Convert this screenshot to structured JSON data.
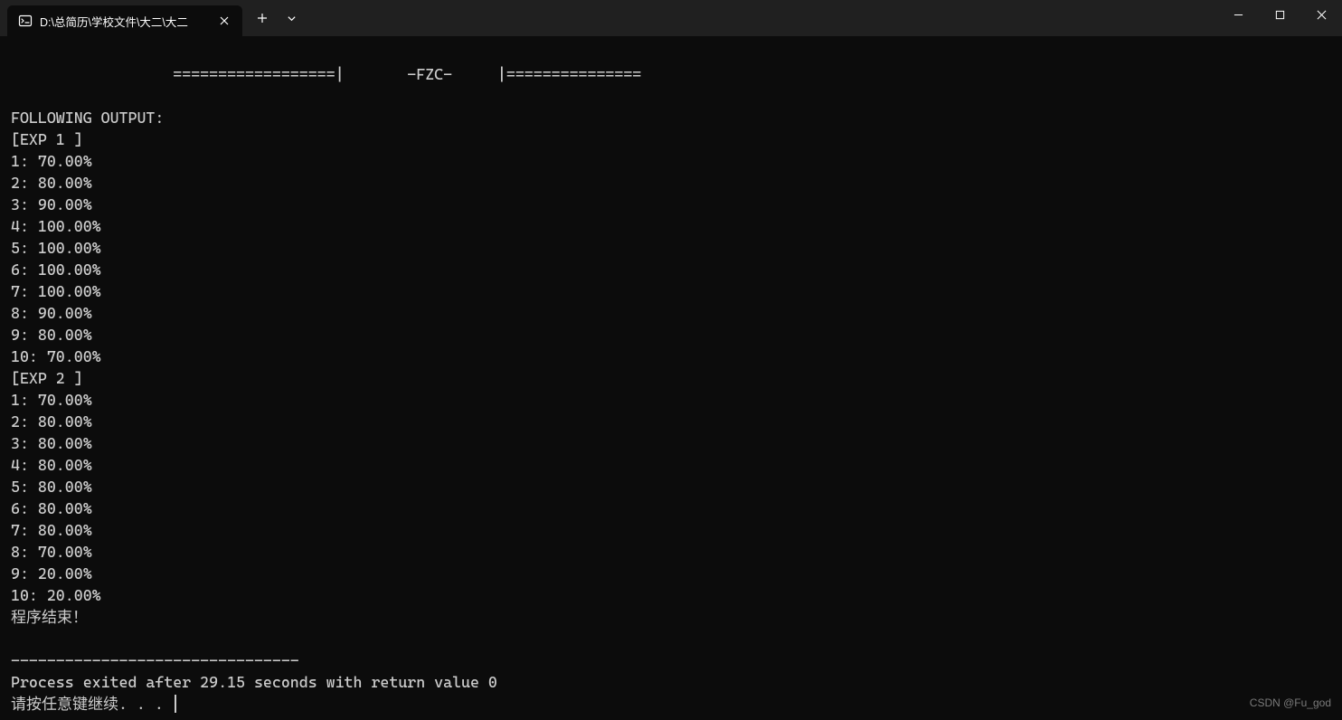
{
  "titlebar": {
    "tab_title": "D:\\总简历\\学校文件\\大二\\大二",
    "new_tab_icon": "＋",
    "dropdown_icon": "⌄"
  },
  "window_controls": {
    "minimize": "—",
    "maximize": "▢",
    "close": "✕"
  },
  "terminal": {
    "banner": "                  ==================|       -FZC-     |===============",
    "following_output": "FOLLOWING OUTPUT:",
    "exp1_header": "[EXP 1 ]",
    "exp1_lines": [
      "1: 70.00%",
      "2: 80.00%",
      "3: 90.00%",
      "4: 100.00%",
      "5: 100.00%",
      "6: 100.00%",
      "7: 100.00%",
      "8: 90.00%",
      "9: 80.00%",
      "10: 70.00%"
    ],
    "exp2_header": "[EXP 2 ]",
    "exp2_lines": [
      "1: 70.00%",
      "2: 80.00%",
      "3: 80.00%",
      "4: 80.00%",
      "5: 80.00%",
      "6: 80.00%",
      "7: 80.00%",
      "8: 70.00%",
      "9: 20.00%",
      "10: 20.00%"
    ],
    "program_end": "程序结束！",
    "separator": "--------------------------------",
    "process_exit": "Process exited after 29.15 seconds with return value 0",
    "press_key": "请按任意键继续. . . "
  },
  "watermark": "CSDN @Fu_god"
}
